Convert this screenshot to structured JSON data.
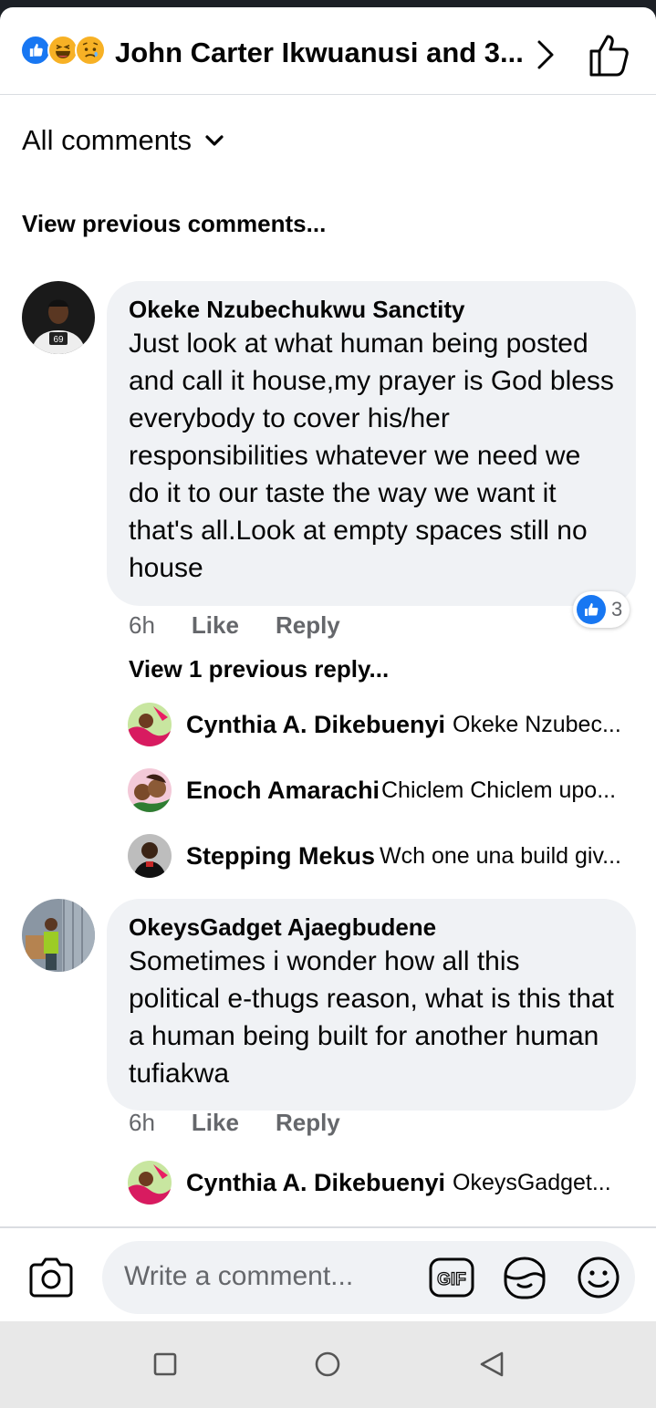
{
  "header": {
    "title": "John Carter Ikwuanusi and 3...",
    "reactions": [
      "like",
      "haha",
      "sad"
    ]
  },
  "filter": {
    "label": "All comments"
  },
  "view_previous_comments": "View previous comments...",
  "comments": [
    {
      "author": "Okeke Nzubechukwu Sanctity",
      "text": "Just look at what human being posted and call it house,my prayer is God bless everybody to cover his/her responsibilities whatever we need we do it to our taste the way we want it that's all.Look at empty spaces still no house",
      "time": "6h",
      "like_label": "Like",
      "reply_label": "Reply",
      "reaction_count": "3",
      "view_replies": "View 1 previous reply...",
      "replies": [
        {
          "author": "Cynthia A. Dikebuenyi",
          "preview": "Okeke Nzubec..."
        },
        {
          "author": "Enoch Amarachi",
          "preview": "Chiclem Chiclem upo..."
        },
        {
          "author": "Stepping Mekus",
          "preview": "Wch one una build giv..."
        }
      ]
    },
    {
      "author": "OkeysGadget Ajaegbudene",
      "text": "Sometimes i wonder how all this political e-thugs reason, what is this that a human being built for another human tufiakwa",
      "time": "6h",
      "like_label": "Like",
      "reply_label": "Reply",
      "replies": [
        {
          "author": "Cynthia A. Dikebuenyi",
          "preview": "OkeysGadget..."
        }
      ]
    }
  ],
  "composer": {
    "placeholder": "Write a comment..."
  },
  "colors": {
    "accent": "#1877f2",
    "bubble": "#f0f2f5",
    "muted": "#65676b"
  }
}
